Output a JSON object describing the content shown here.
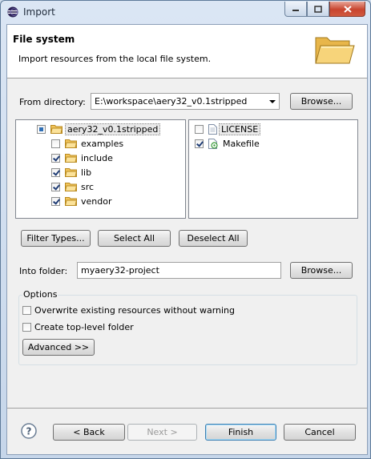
{
  "window": {
    "title": "Import"
  },
  "banner": {
    "title": "File system",
    "description": "Import resources from the local file system."
  },
  "source": {
    "label": "From directory:",
    "value": "E:\\workspace\\aery32_v0.1stripped",
    "browse_label": "Browse..."
  },
  "tree": {
    "root": {
      "label": "aery32_v0.1stripped",
      "state": "partial"
    },
    "children": [
      {
        "label": "examples",
        "checked": false
      },
      {
        "label": "include",
        "checked": true
      },
      {
        "label": "lib",
        "checked": true
      },
      {
        "label": "src",
        "checked": true
      },
      {
        "label": "vendor",
        "checked": true
      }
    ]
  },
  "files": [
    {
      "label": "LICENSE",
      "checked": false,
      "icon": "text-file-icon"
    },
    {
      "label": "Makefile",
      "checked": true,
      "icon": "makefile-icon"
    }
  ],
  "selection_buttons": {
    "filter_types": "Filter Types...",
    "select_all": "Select All",
    "deselect_all": "Deselect All"
  },
  "destination": {
    "label": "Into folder:",
    "value": "myaery32-project",
    "browse_label": "Browse..."
  },
  "options": {
    "title": "Options",
    "overwrite": {
      "label": "Overwrite existing resources without warning",
      "checked": false
    },
    "top_level": {
      "label": "Create top-level folder",
      "checked": false
    },
    "advanced_label": "Advanced >>"
  },
  "footer": {
    "back_label": "< Back",
    "next_label": "Next >",
    "finish_label": "Finish",
    "cancel_label": "Cancel"
  },
  "colors": {
    "checkbox_check": "#213e76",
    "folder": "#f2c55c",
    "default_button_border": "#3c7fb1"
  }
}
